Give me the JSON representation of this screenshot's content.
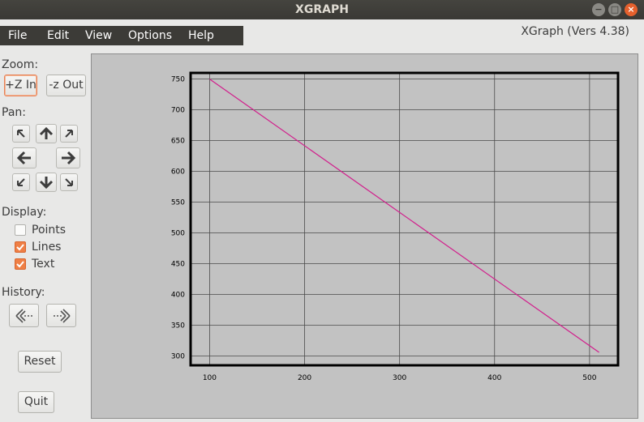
{
  "window": {
    "title": "XGRAPH",
    "version": "XGraph (Vers 4.38)",
    "controls": {
      "minimize": "−",
      "maximize": "□",
      "close": "×"
    }
  },
  "menu": [
    "File",
    "Edit",
    "View",
    "Options",
    "Help"
  ],
  "zoom": {
    "label": "Zoom:",
    "zoom_in": "+Z In",
    "zoom_out": "-z Out"
  },
  "pan": {
    "label": "Pan:",
    "icons": [
      "arrow-up-left-icon",
      "arrow-up-icon",
      "arrow-up-right-icon",
      "arrow-left-icon",
      "arrow-right-icon",
      "arrow-down-left-icon",
      "arrow-down-icon",
      "arrow-down-right-icon"
    ]
  },
  "display": {
    "label": "Display:",
    "options": [
      {
        "label": "Points",
        "checked": false
      },
      {
        "label": "Lines",
        "checked": true
      },
      {
        "label": "Text",
        "checked": true
      }
    ]
  },
  "history": {
    "label": "History:",
    "back_icon": "history-back-icon",
    "forward_icon": "history-forward-icon"
  },
  "reset_label": "Reset",
  "quit_label": "Quit",
  "colors": {
    "line": "#d21e8c",
    "accent": "#ef7f45",
    "plot_bg": "#c2c2c2"
  },
  "chart_data": {
    "type": "line",
    "title": "",
    "xlabel": "",
    "ylabel": "",
    "x_ticks": [
      100,
      200,
      300,
      400,
      500
    ],
    "y_ticks": [
      300,
      350,
      400,
      450,
      500,
      550,
      600,
      650,
      700,
      750
    ],
    "xlim": [
      80,
      530
    ],
    "ylim": [
      285,
      760
    ],
    "grid": true,
    "series": [
      {
        "x": [
          100,
          510
        ],
        "y": [
          750,
          306
        ]
      }
    ]
  }
}
